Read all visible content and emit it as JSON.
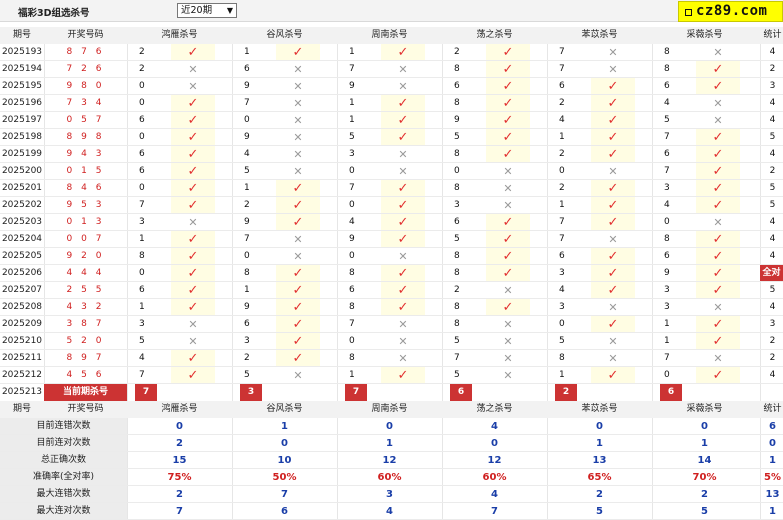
{
  "header": {
    "title": "福彩3D组选杀号",
    "period_select": "近20期",
    "logo_text": "cz89.com"
  },
  "columns": {
    "issue": "期号",
    "draw": "开奖号码",
    "methods": [
      "鸿雁杀号",
      "谷风杀号",
      "周南杀号",
      "荡之杀号",
      "苯苡杀号",
      "采薇杀号"
    ],
    "total": "统计"
  },
  "rows": [
    {
      "issue": "2025193",
      "draw": "8 7 6",
      "kills": [
        {
          "n": "2",
          "ok": true
        },
        {
          "n": "1",
          "ok": true
        },
        {
          "n": "1",
          "ok": true
        },
        {
          "n": "2",
          "ok": true
        },
        {
          "n": "7",
          "ok": false
        },
        {
          "n": "8",
          "ok": false
        }
      ],
      "total": "4"
    },
    {
      "issue": "2025194",
      "draw": "7 2 6",
      "kills": [
        {
          "n": "2",
          "ok": false
        },
        {
          "n": "6",
          "ok": false
        },
        {
          "n": "7",
          "ok": false
        },
        {
          "n": "8",
          "ok": true
        },
        {
          "n": "7",
          "ok": false
        },
        {
          "n": "8",
          "ok": true
        }
      ],
      "total": "2"
    },
    {
      "issue": "2025195",
      "draw": "9 8 0",
      "kills": [
        {
          "n": "0",
          "ok": false
        },
        {
          "n": "9",
          "ok": false
        },
        {
          "n": "9",
          "ok": false
        },
        {
          "n": "6",
          "ok": true
        },
        {
          "n": "6",
          "ok": true
        },
        {
          "n": "6",
          "ok": true
        }
      ],
      "total": "3"
    },
    {
      "issue": "2025196",
      "draw": "7 3 4",
      "kills": [
        {
          "n": "0",
          "ok": true
        },
        {
          "n": "7",
          "ok": false
        },
        {
          "n": "1",
          "ok": true
        },
        {
          "n": "8",
          "ok": true
        },
        {
          "n": "2",
          "ok": true
        },
        {
          "n": "4",
          "ok": false
        }
      ],
      "total": "4"
    },
    {
      "issue": "2025197",
      "draw": "0 5 7",
      "kills": [
        {
          "n": "6",
          "ok": true
        },
        {
          "n": "0",
          "ok": false
        },
        {
          "n": "1",
          "ok": true
        },
        {
          "n": "9",
          "ok": true
        },
        {
          "n": "4",
          "ok": true
        },
        {
          "n": "5",
          "ok": false
        }
      ],
      "total": "4"
    },
    {
      "issue": "2025198",
      "draw": "8 9 8",
      "kills": [
        {
          "n": "0",
          "ok": true
        },
        {
          "n": "9",
          "ok": false
        },
        {
          "n": "5",
          "ok": true
        },
        {
          "n": "5",
          "ok": true
        },
        {
          "n": "1",
          "ok": true
        },
        {
          "n": "7",
          "ok": true
        }
      ],
      "total": "5"
    },
    {
      "issue": "2025199",
      "draw": "9 4 3",
      "kills": [
        {
          "n": "6",
          "ok": true
        },
        {
          "n": "4",
          "ok": false
        },
        {
          "n": "3",
          "ok": false
        },
        {
          "n": "8",
          "ok": true
        },
        {
          "n": "2",
          "ok": true
        },
        {
          "n": "6",
          "ok": true
        }
      ],
      "total": "4"
    },
    {
      "issue": "2025200",
      "draw": "0 1 5",
      "kills": [
        {
          "n": "6",
          "ok": true
        },
        {
          "n": "5",
          "ok": false
        },
        {
          "n": "0",
          "ok": false
        },
        {
          "n": "0",
          "ok": false
        },
        {
          "n": "0",
          "ok": false
        },
        {
          "n": "7",
          "ok": true
        }
      ],
      "total": "2"
    },
    {
      "issue": "2025201",
      "draw": "8 4 6",
      "kills": [
        {
          "n": "0",
          "ok": true
        },
        {
          "n": "1",
          "ok": true
        },
        {
          "n": "7",
          "ok": true
        },
        {
          "n": "8",
          "ok": false
        },
        {
          "n": "2",
          "ok": true
        },
        {
          "n": "3",
          "ok": true
        }
      ],
      "total": "5"
    },
    {
      "issue": "2025202",
      "draw": "9 5 3",
      "kills": [
        {
          "n": "7",
          "ok": true
        },
        {
          "n": "2",
          "ok": true
        },
        {
          "n": "0",
          "ok": true
        },
        {
          "n": "3",
          "ok": false
        },
        {
          "n": "1",
          "ok": true
        },
        {
          "n": "4",
          "ok": true
        }
      ],
      "total": "5"
    },
    {
      "issue": "2025203",
      "draw": "0 1 3",
      "kills": [
        {
          "n": "3",
          "ok": false
        },
        {
          "n": "9",
          "ok": true
        },
        {
          "n": "4",
          "ok": true
        },
        {
          "n": "6",
          "ok": true
        },
        {
          "n": "7",
          "ok": true
        },
        {
          "n": "0",
          "ok": false
        }
      ],
      "total": "4"
    },
    {
      "issue": "2025204",
      "draw": "0 0 7",
      "kills": [
        {
          "n": "1",
          "ok": true
        },
        {
          "n": "7",
          "ok": false
        },
        {
          "n": "9",
          "ok": true
        },
        {
          "n": "5",
          "ok": true
        },
        {
          "n": "7",
          "ok": false
        },
        {
          "n": "8",
          "ok": true
        }
      ],
      "total": "4"
    },
    {
      "issue": "2025205",
      "draw": "9 2 0",
      "kills": [
        {
          "n": "8",
          "ok": true
        },
        {
          "n": "0",
          "ok": false
        },
        {
          "n": "0",
          "ok": false
        },
        {
          "n": "8",
          "ok": true
        },
        {
          "n": "6",
          "ok": true
        },
        {
          "n": "6",
          "ok": true
        }
      ],
      "total": "4"
    },
    {
      "issue": "2025206",
      "draw": "4 4 4",
      "kills": [
        {
          "n": "0",
          "ok": true
        },
        {
          "n": "8",
          "ok": true
        },
        {
          "n": "8",
          "ok": true
        },
        {
          "n": "8",
          "ok": true
        },
        {
          "n": "3",
          "ok": true
        },
        {
          "n": "9",
          "ok": true
        }
      ],
      "total": "全对"
    },
    {
      "issue": "2025207",
      "draw": "2 5 5",
      "kills": [
        {
          "n": "6",
          "ok": true
        },
        {
          "n": "1",
          "ok": true
        },
        {
          "n": "6",
          "ok": true
        },
        {
          "n": "2",
          "ok": false
        },
        {
          "n": "4",
          "ok": true
        },
        {
          "n": "3",
          "ok": true
        }
      ],
      "total": "5"
    },
    {
      "issue": "2025208",
      "draw": "4 3 2",
      "kills": [
        {
          "n": "1",
          "ok": true
        },
        {
          "n": "9",
          "ok": true
        },
        {
          "n": "8",
          "ok": true
        },
        {
          "n": "8",
          "ok": true
        },
        {
          "n": "3",
          "ok": false
        },
        {
          "n": "3",
          "ok": false
        }
      ],
      "total": "4"
    },
    {
      "issue": "2025209",
      "draw": "3 8 7",
      "kills": [
        {
          "n": "3",
          "ok": false
        },
        {
          "n": "6",
          "ok": true
        },
        {
          "n": "7",
          "ok": false
        },
        {
          "n": "8",
          "ok": false
        },
        {
          "n": "0",
          "ok": true
        },
        {
          "n": "1",
          "ok": true
        }
      ],
      "total": "3"
    },
    {
      "issue": "2025210",
      "draw": "5 2 0",
      "kills": [
        {
          "n": "5",
          "ok": false
        },
        {
          "n": "3",
          "ok": true
        },
        {
          "n": "0",
          "ok": false
        },
        {
          "n": "5",
          "ok": false
        },
        {
          "n": "5",
          "ok": false
        },
        {
          "n": "1",
          "ok": true
        }
      ],
      "total": "2"
    },
    {
      "issue": "2025211",
      "draw": "8 9 7",
      "kills": [
        {
          "n": "4",
          "ok": true
        },
        {
          "n": "2",
          "ok": true
        },
        {
          "n": "8",
          "ok": false
        },
        {
          "n": "7",
          "ok": false
        },
        {
          "n": "8",
          "ok": false
        },
        {
          "n": "7",
          "ok": false
        }
      ],
      "total": "2"
    },
    {
      "issue": "2025212",
      "draw": "4 5 6",
      "kills": [
        {
          "n": "7",
          "ok": true
        },
        {
          "n": "5",
          "ok": false
        },
        {
          "n": "1",
          "ok": true
        },
        {
          "n": "5",
          "ok": false
        },
        {
          "n": "1",
          "ok": true
        },
        {
          "n": "0",
          "ok": true
        }
      ],
      "total": "4"
    }
  ],
  "current": {
    "issue": "2025213",
    "label": "当前期杀号",
    "kills": [
      "7",
      "3",
      "7",
      "6",
      "2",
      "6"
    ]
  },
  "stats": [
    {
      "label": "目前连错次数",
      "values": [
        "0",
        "1",
        "0",
        "4",
        "0",
        "0"
      ],
      "total": "6",
      "pct": false
    },
    {
      "label": "目前连对次数",
      "values": [
        "2",
        "0",
        "1",
        "0",
        "1",
        "1"
      ],
      "total": "0",
      "pct": false
    },
    {
      "label": "总正确次数",
      "values": [
        "15",
        "10",
        "12",
        "12",
        "13",
        "14"
      ],
      "total": "1",
      "pct": false
    },
    {
      "label": "准确率(全对率)",
      "values": [
        "75%",
        "50%",
        "60%",
        "60%",
        "65%",
        "70%"
      ],
      "total": "5%",
      "pct": true
    },
    {
      "label": "最大连错次数",
      "values": [
        "2",
        "7",
        "3",
        "4",
        "2",
        "2"
      ],
      "total": "13",
      "pct": false
    },
    {
      "label": "最大连对次数",
      "values": [
        "7",
        "6",
        "4",
        "7",
        "5",
        "5"
      ],
      "total": "1",
      "pct": false
    }
  ],
  "symbols": {
    "ok": "✓",
    "ng": "✕"
  },
  "colors": {
    "accent_red": "#cc3333",
    "ok_red": "#e23030",
    "stat_blue": "#1a3ea8",
    "highlight": "#fffde3",
    "logo_bg": "#ffff00"
  }
}
